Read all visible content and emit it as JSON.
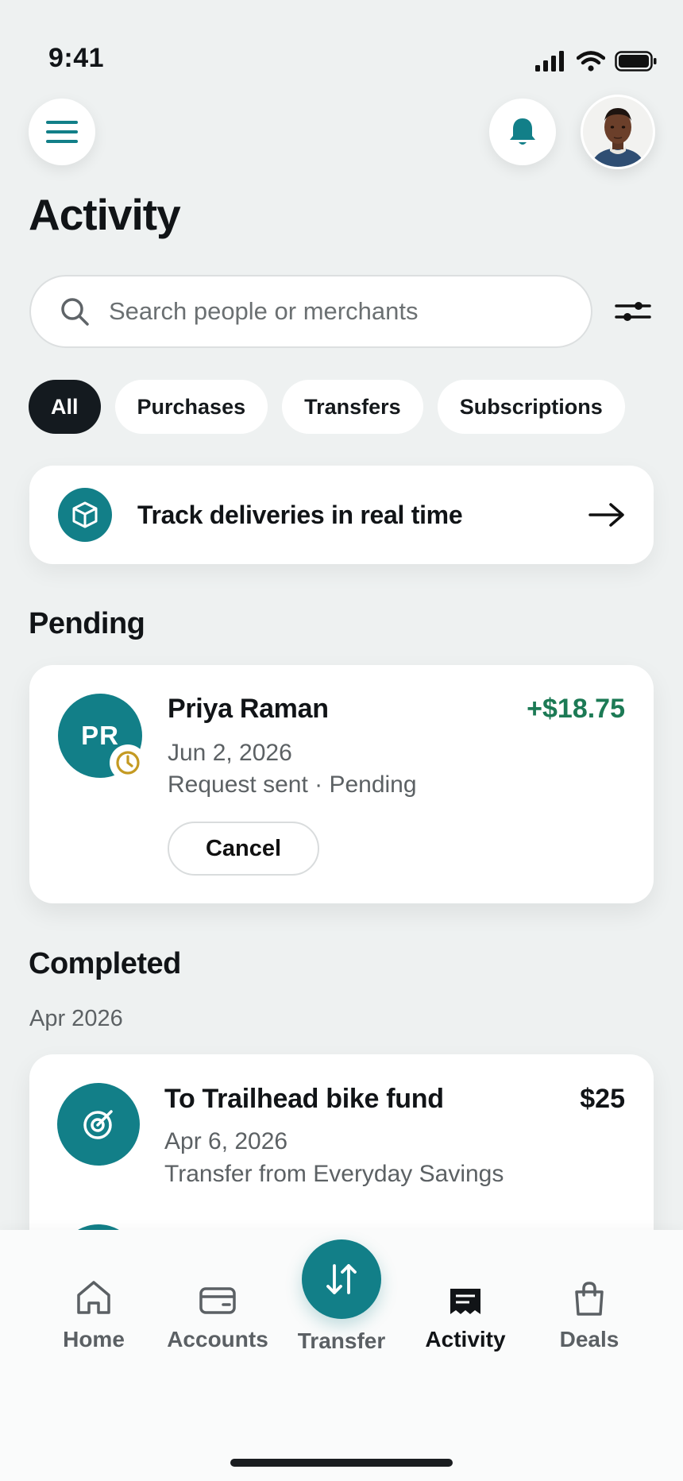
{
  "status_bar": {
    "time": "9:41"
  },
  "header": {
    "menu_icon": "hamburger-menu-icon",
    "bell_icon": "bell-icon",
    "avatar": "user-avatar-photo"
  },
  "page": {
    "title": "Activity"
  },
  "search": {
    "placeholder": "Search people or merchants",
    "value": ""
  },
  "filters": {
    "chips": [
      {
        "label": "All",
        "active": true
      },
      {
        "label": "Purchases",
        "active": false
      },
      {
        "label": "Transfers",
        "active": false
      },
      {
        "label": "Subscriptions",
        "active": false
      }
    ]
  },
  "promo": {
    "text": "Track deliveries in real time",
    "icon": "package-box-icon"
  },
  "pending": {
    "section_title": "Pending",
    "transaction": {
      "initials": "PR",
      "name": "Priya Raman",
      "amount": "+$18.75",
      "date": "Jun 2, 2026",
      "status": "Request sent · Pending",
      "cancel_label": "Cancel"
    }
  },
  "completed": {
    "section_title": "Completed",
    "month": "Apr 2026",
    "transaction": {
      "name": "To Trailhead bike fund",
      "amount": "$25",
      "date": "Apr 6, 2026",
      "detail": "Transfer from Everyday Savings"
    }
  },
  "bottom_nav": {
    "items": [
      {
        "label": "Home",
        "icon": "home-icon"
      },
      {
        "label": "Accounts",
        "icon": "wallet-icon"
      },
      {
        "label": "Transfer",
        "icon": "transfer-arrows-icon"
      },
      {
        "label": "Activity",
        "icon": "receipt-icon",
        "active": true
      },
      {
        "label": "Deals",
        "icon": "shopping-bag-icon"
      }
    ]
  },
  "colors": {
    "accent": "#127f88",
    "positive": "#1c7a55",
    "dark": "#141a1f",
    "clock_badge": "#c49a22"
  }
}
